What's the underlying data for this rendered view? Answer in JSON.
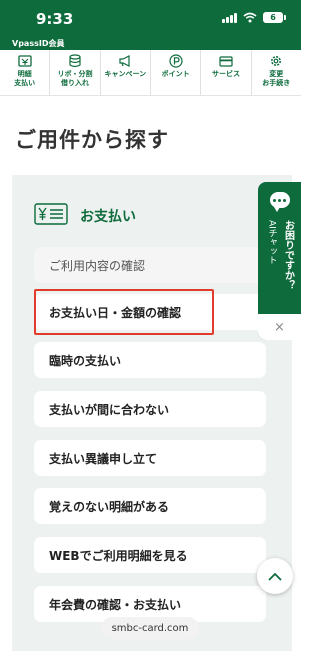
{
  "status_bar": {
    "time": "9:33",
    "battery": "6"
  },
  "member_label": "VpassID会員",
  "nav": {
    "items": [
      {
        "label": "明細\n支払い",
        "icon": "statement-icon"
      },
      {
        "label": "リボ・分割\n借り入れ",
        "icon": "coins-icon"
      },
      {
        "label": "キャンペーン",
        "icon": "megaphone-icon"
      },
      {
        "label": "ポイント",
        "icon": "point-icon"
      },
      {
        "label": "サービス",
        "icon": "card-icon"
      },
      {
        "label": "変更\nお手続き",
        "icon": "gear-icon"
      }
    ]
  },
  "section_title": "ご用件から探す",
  "panel": {
    "header_label": "お支払い",
    "header_icon": "yen-list-icon",
    "items": [
      "ご利用内容の確認",
      "お支払い日・金額の確認",
      "臨時の支払い",
      "支払いが間に合わない",
      "支払い異議申し立て",
      "覚えのない明細がある",
      "WEBでご利用明細を見る",
      "年会費の確認・お支払い"
    ]
  },
  "chat": {
    "title": "お困りですか？",
    "subtitle": "AIチャット",
    "close": "×"
  },
  "url": "smbc-card.com",
  "colors": {
    "brand_green": "#0d6b3c",
    "panel_bg": "#edf1ef",
    "highlight": "#e23b2e"
  }
}
